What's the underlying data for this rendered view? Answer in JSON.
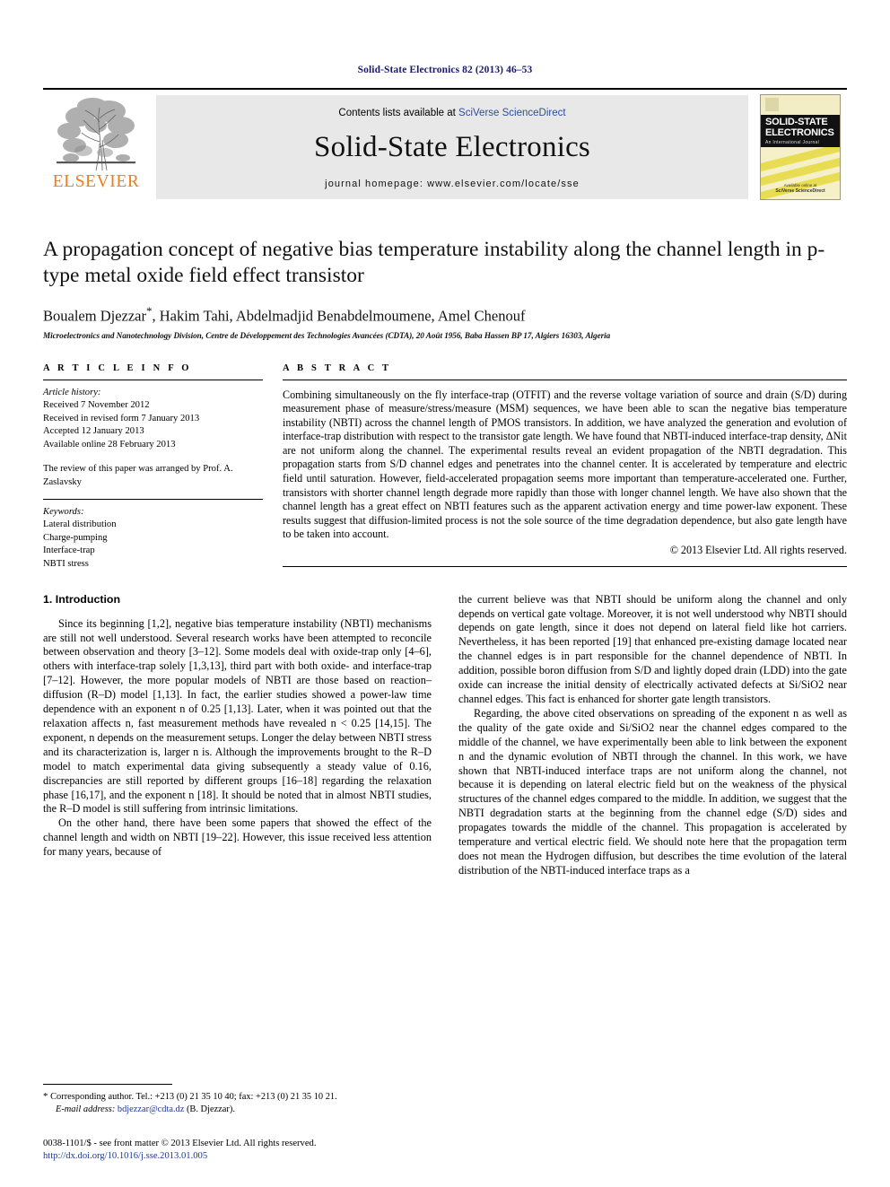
{
  "running_head": "Solid-State Electronics 82 (2013) 46–53",
  "masthead": {
    "publisher_name": "ELSEVIER",
    "contents_prefix": "Contents lists available at ",
    "contents_link": "SciVerse ScienceDirect",
    "journal_title": "Solid-State Electronics",
    "homepage": "journal homepage: www.elsevier.com/locate/sse",
    "cover": {
      "line1": "SOLID-STATE",
      "line2": "ELECTRONICS",
      "line3": "An International Journal",
      "foot_small": "Available online at",
      "foot_bold": "SciVerse ScienceDirect"
    }
  },
  "article": {
    "title": "A propagation concept of negative bias temperature instability along the channel length in p-type metal oxide field effect transistor",
    "authors": "Boualem Djezzar",
    "authors_rest": ", Hakim Tahi, Abdelmadjid Benabdelmoumene, Amel Chenouf",
    "corresponding_mark": "*",
    "affiliation": "Microelectronics and Nanotechnology Division, Centre de Développement des Technologies Avancées (CDTA), 20 Août 1956, Baba Hassen BP 17, Algiers 16303, Algeria"
  },
  "info": {
    "heading": "A R T I C L E   I N F O",
    "history_label": "Article history:",
    "history": [
      "Received 7 November 2012",
      "Received in revised form 7 January 2013",
      "Accepted 12 January 2013",
      "Available online 28 February 2013"
    ],
    "editor_note": "The review of this paper was arranged by Prof. A. Zaslavsky",
    "keywords_label": "Keywords:",
    "keywords": [
      "Lateral distribution",
      "Charge-pumping",
      "Interface-trap",
      "NBTI stress"
    ]
  },
  "abstract": {
    "heading": "A B S T R A C T",
    "text": "Combining simultaneously on the fly interface-trap (OTFIT) and the reverse voltage variation of source and drain (S/D) during measurement phase of measure/stress/measure (MSM) sequences, we have been able to scan the negative bias temperature instability (NBTI) across the channel length of PMOS transistors. In addition, we have analyzed the generation and evolution of interface-trap distribution with respect to the transistor gate length. We have found that NBTI-induced interface-trap density, ΔNit are not uniform along the channel. The experimental results reveal an evident propagation of the NBTI degradation. This propagation starts from S/D channel edges and penetrates into the channel center. It is accelerated by temperature and electric field until saturation. However, field-accelerated propagation seems more important than temperature-accelerated one. Further, transistors with shorter channel length degrade more rapidly than those with longer channel length. We have also shown that the channel length has a great effect on NBTI features such as the apparent activation energy and time power-law exponent. These results suggest that diffusion-limited process is not the sole source of the time degradation dependence, but also gate length have to be taken into account.",
    "copyright": "© 2013 Elsevier Ltd. All rights reserved."
  },
  "body": {
    "section_title": "1. Introduction",
    "left_paragraphs": [
      "Since its beginning [1,2], negative bias temperature instability (NBTI) mechanisms are still not well understood. Several research works have been attempted to reconcile between observation and theory [3–12]. Some models deal with oxide-trap only [4–6], others with interface-trap solely [1,3,13], third part with both oxide- and interface-trap [7–12]. However, the more popular models of NBTI are those based on reaction–diffusion (R–D) model [1,13]. In fact, the earlier studies showed a power-law time dependence with an exponent n of 0.25 [1,13]. Later, when it was pointed out that the relaxation affects n, fast measurement methods have revealed n < 0.25 [14,15]. The exponent, n depends on the measurement setups. Longer the delay between NBTI stress and its characterization is, larger n is. Although the improvements brought to the R–D model to match experimental data giving subsequently a steady value of 0.16, discrepancies are still reported by different groups [16–18] regarding the relaxation phase [16,17], and the exponent n [18]. It should be noted that in almost NBTI studies, the R–D model is still suffering from intrinsic limitations.",
      "On the other hand, there have been some papers that showed the effect of the channel length and width on NBTI [19–22]. However, this issue received less attention for many years, because of"
    ],
    "right_paragraphs": [
      "the current believe was that NBTI should be uniform along the channel and only depends on vertical gate voltage. Moreover, it is not well understood why NBTI should depends on gate length, since it does not depend on lateral field like hot carriers. Nevertheless, it has been reported [19] that enhanced pre-existing damage located near the channel edges is in part responsible for the channel dependence of NBTI. In addition, possible boron diffusion from S/D and lightly doped drain (LDD) into the gate oxide can increase the initial density of electrically activated defects at Si/SiO2 near channel edges. This fact is enhanced for shorter gate length transistors.",
      "Regarding, the above cited observations on spreading of the exponent n as well as the quality of the gate oxide and Si/SiO2 near the channel edges compared to the middle of the channel, we have experimentally been able to link between the exponent n and the dynamic evolution of NBTI through the channel. In this work, we have shown that NBTI-induced interface traps are not uniform along the channel, not because it is depending on lateral electric field but on the weakness of the physical structures of the channel edges compared to the middle. In addition, we suggest that the NBTI degradation starts at the beginning from the channel edge (S/D) sides and propagates towards the middle of the channel. This propagation is accelerated by temperature and vertical electric field. We should note here that the propagation term does not mean the Hydrogen diffusion, but describes the time evolution of the lateral distribution of the NBTI-induced interface traps as a"
    ]
  },
  "footnote": {
    "marker": "*",
    "corresponding": "Corresponding author. Tel.: +213 (0) 21 35 10 40; fax: +213 (0) 21 35 10 21.",
    "email_label": "E-mail address:",
    "email": "bdjezzar@cdta.dz",
    "email_owner": "(B. Djezzar)."
  },
  "footer": {
    "issn_line": "0038-1101/$ - see front matter © 2013 Elsevier Ltd. All rights reserved.",
    "doi": "http://dx.doi.org/10.1016/j.sse.2013.01.005"
  },
  "colors": {
    "running_head": "#1a1a6e",
    "elsevier_orange": "#ef7d1a",
    "link_blue": "#2b4ea2",
    "ref_blue": "#1a3a8f",
    "masthead_grey": "#e8e8e8"
  }
}
